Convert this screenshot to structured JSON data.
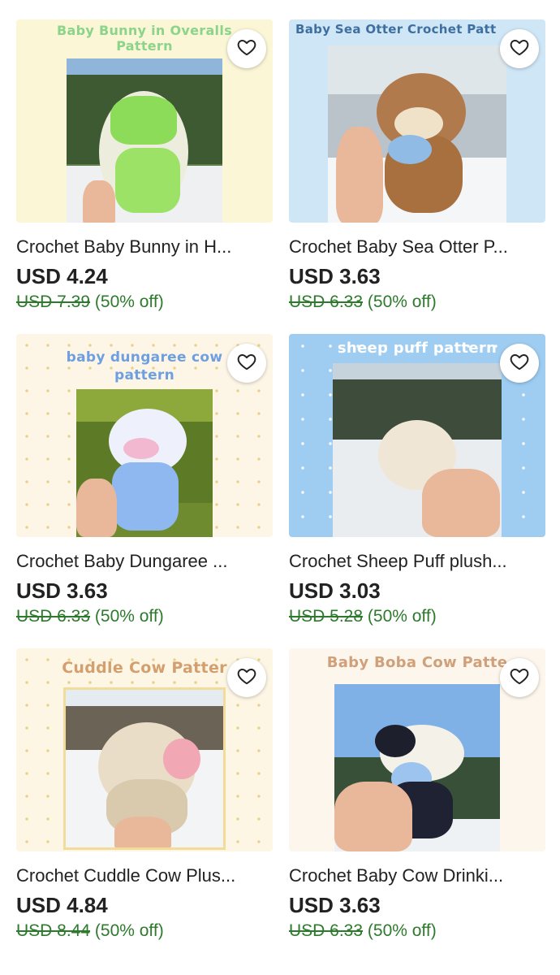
{
  "listings": [
    {
      "banner": "Baby Bunny in Overalls Pattern",
      "banner_lines": [
        "Baby Bunny in Overalls",
        "Pattern"
      ],
      "title": "Crochet Baby Bunny in H...",
      "price": "USD 4.24",
      "original_price": "USD 7.39",
      "discount": "(50% off)",
      "favorite_icon": "heart-outline-icon"
    },
    {
      "banner": "Baby Sea Otter Crochet Patt",
      "banner_lines": [
        "Baby Sea Otter Crochet Patt"
      ],
      "title": "Crochet Baby Sea Otter P...",
      "price": "USD 3.63",
      "original_price": "USD 6.33",
      "discount": "(50% off)",
      "favorite_icon": "heart-outline-icon"
    },
    {
      "banner": "baby dungaree cow pattern",
      "banner_lines": [
        "baby dungaree cow",
        "pattern"
      ],
      "title": "Crochet Baby Dungaree ...",
      "price": "USD 3.63",
      "original_price": "USD 6.33",
      "discount": "(50% off)",
      "favorite_icon": "heart-outline-icon"
    },
    {
      "banner": "sheep puff pattern",
      "banner_lines": [
        "sheep puff pattern"
      ],
      "title": "Crochet Sheep Puff plush...",
      "price": "USD 3.03",
      "original_price": "USD 5.28",
      "discount": "(50% off)",
      "favorite_icon": "heart-outline-icon"
    },
    {
      "banner": "Cuddle Cow Patter",
      "banner_lines": [
        "Cuddle Cow Patter"
      ],
      "title": "Crochet Cuddle Cow Plus...",
      "price": "USD 4.84",
      "original_price": "USD 8.44",
      "discount": "(50% off)",
      "favorite_icon": "heart-outline-icon"
    },
    {
      "banner": "Baby Boba Cow Patte",
      "banner_lines": [
        "Baby Boba Cow Patte"
      ],
      "title": "Crochet Baby Cow Drinki...",
      "price": "USD 3.63",
      "original_price": "USD 6.33",
      "discount": "(50% off)",
      "favorite_icon": "heart-outline-icon"
    }
  ],
  "colors": {
    "price_text": "#222222",
    "discount_green": "#2d7a2d",
    "card1_bg": "#fbf6d6",
    "card1_banner": "#8bd48a",
    "card2_bg": "#cfe6f7",
    "card2_banner": "#3e6f9f",
    "card3_bg": "#fdf6e7",
    "card3_banner": "#6e9fe0",
    "card4_bg": "#9fcdf2",
    "card4_banner": "#ffffff",
    "card5_bg": "#fdf6e4",
    "card5_banner": "#d49f6e",
    "card6_bg": "#fdf6ec",
    "card6_banner": "#cfa07a"
  }
}
